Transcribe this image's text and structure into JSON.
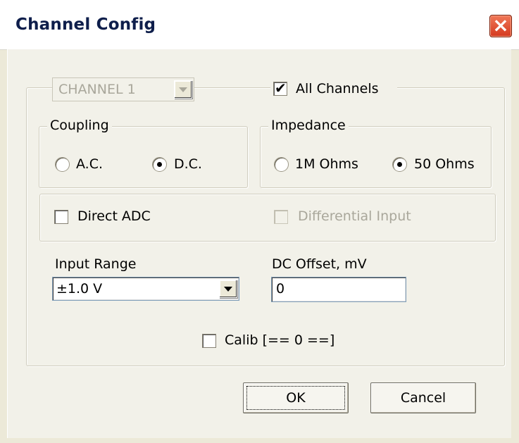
{
  "window": {
    "title": "Channel Config",
    "close_symbol": "×"
  },
  "channel": {
    "selected": "CHANNEL 1",
    "all_channels_label": "All Channels",
    "all_channels_checked": true
  },
  "coupling": {
    "label": "Coupling",
    "options": [
      "A.C.",
      "D.C."
    ],
    "selected": "D.C."
  },
  "impedance": {
    "label": "Impedance",
    "options": [
      "1M Ohms",
      "50 Ohms"
    ],
    "selected": "50 Ohms"
  },
  "direct_adc": {
    "label": "Direct ADC",
    "checked": false
  },
  "differential": {
    "label": "Differential Input",
    "checked": false,
    "enabled": false
  },
  "input_range": {
    "label": "Input Range",
    "value": "±1.0 V"
  },
  "dc_offset": {
    "label": "DC Offset, mV",
    "value": "0"
  },
  "calib": {
    "label": "Calib [== 0 ==]",
    "checked": false
  },
  "buttons": {
    "ok": "OK",
    "cancel": "Cancel"
  },
  "colors": {
    "dialog_bg": "#F2F1E9",
    "titlebar_bg": "#FFFFFF",
    "title_text": "#0E1E4B",
    "close_red": "#D4381E",
    "disabled_text": "#A9A79B"
  }
}
